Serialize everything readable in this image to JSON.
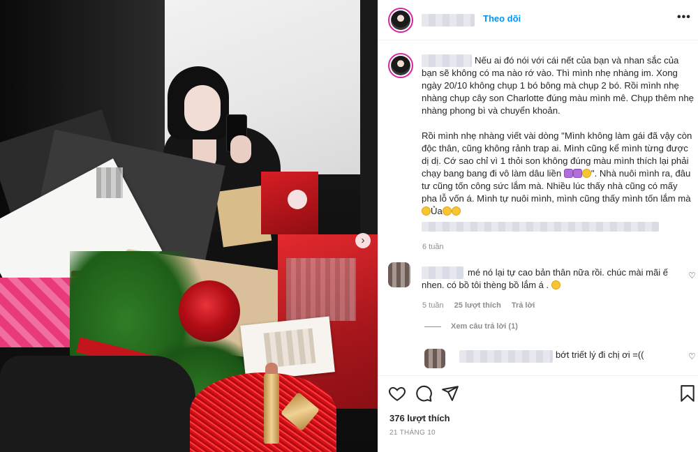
{
  "header": {
    "follow_label": "Theo dõi",
    "more_label": "•••"
  },
  "post": {
    "caption": [
      "Nếu ai đó nói với cái nết của bạn và nhan sắc của bạn sẽ không có ma nào rớ vào. Thì mình nhẹ nhàng im. Xong ngày 20/10 không chụp 1 bó bông mà chụp 2 bó. Rồi mình nhẹ nhàng chụp cây son Charlotte đúng màu mình mê. Chụp thêm nhẹ nhàng phong bì và chuyển khoản.",
      "Rồi mình nhẹ nhàng viết vài dòng \"Mình không làm gái đã vậy còn độc thân, cũng không rảnh trap ai. Mình cũng kể mình từng được dị dị. Cớ sao chỉ vì 1 thỏi son không đúng màu mình thích lại phải chạy bang bang đi vô làm dâu liền",
      "\". Nhà nuôi mình ra, đâu tư cũng tốn công sức lắm mà. Nhiều lúc thấy nhà cũng có mấy pha lỗ vốn á. Mình tự nuôi mình, mình cũng thấy mình tốn lắm mà",
      "Ủa"
    ],
    "time": "6 tuần",
    "likes": "376 lượt thích",
    "date": "21 THÁNG 10"
  },
  "comments": [
    {
      "text": "mé nó lại tự cao bản thân nữa rồi. chúc mài mãi ế nhen. có bồ tôi thèng bồ lắm á .",
      "time": "5 tuần",
      "likes": "25 lượt thích",
      "reply_label": "Trả lời",
      "view_replies": "Xem câu trả lời (1)"
    },
    {
      "text": "bớt triết lý đi chị ơi =(("
    }
  ],
  "icons": {
    "next": "chevron-right-icon",
    "like": "heart-icon",
    "comment": "comment-icon",
    "share": "share-icon",
    "save": "bookmark-icon"
  },
  "colors": {
    "link_blue": "#0095f6",
    "story_ring": "#d6249f",
    "muted": "#8e8e8e"
  }
}
